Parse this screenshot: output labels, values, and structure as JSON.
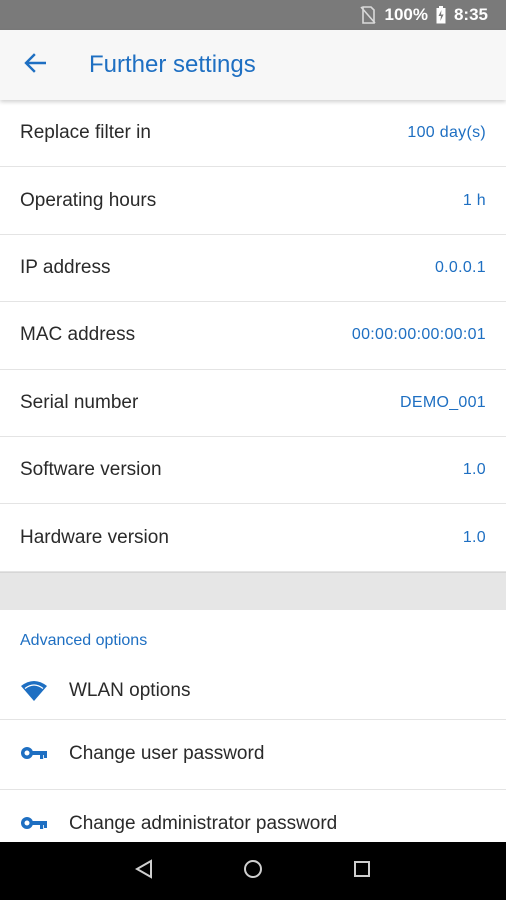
{
  "status_bar": {
    "battery": "100%",
    "time": "8:35"
  },
  "app_bar": {
    "title": "Further settings",
    "back_icon": "arrow-back-icon"
  },
  "info_rows": [
    {
      "label": "Replace filter in",
      "value": "100 day(s)"
    },
    {
      "label": "Operating hours",
      "value": "1 h"
    },
    {
      "label": "IP address",
      "value": "0.0.0.1"
    },
    {
      "label": "MAC address",
      "value": "00:00:00:00:00:01"
    },
    {
      "label": "Serial number",
      "value": "DEMO_001"
    },
    {
      "label": "Software version",
      "value": "1.0"
    },
    {
      "label": "Hardware version",
      "value": "1.0"
    }
  ],
  "advanced": {
    "header": "Advanced options",
    "items": [
      {
        "label": "WLAN options",
        "icon": "wifi-icon"
      },
      {
        "label": "Change user password",
        "icon": "key-icon"
      },
      {
        "label": "Change administrator password",
        "icon": "key-icon"
      }
    ]
  },
  "colors": {
    "accent": "#1e6fc2",
    "status_bar": "#7a7a7a",
    "nav_bar": "#000000"
  }
}
